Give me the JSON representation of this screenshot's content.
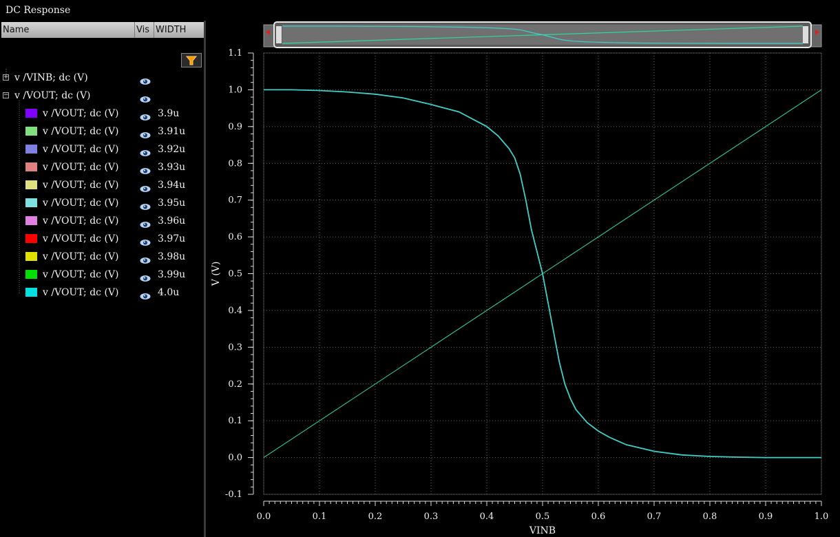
{
  "window": {
    "title": "DC Response"
  },
  "panel": {
    "columns": {
      "name": "Name",
      "vis": "Vis",
      "width": "WIDTH"
    },
    "rows": [
      {
        "label": "v /VINB; dc (V)",
        "expander": "+",
        "color": "",
        "value": ""
      },
      {
        "label": "v /VOUT; dc (V)",
        "expander": "−",
        "color": "",
        "value": ""
      },
      {
        "label": "v /VOUT; dc (V)",
        "color": "#8000ff",
        "value": "3.9u"
      },
      {
        "label": "v /VOUT; dc (V)",
        "color": "#80e080",
        "value": "3.91u"
      },
      {
        "label": "v /VOUT; dc (V)",
        "color": "#8080e0",
        "value": "3.92u"
      },
      {
        "label": "v /VOUT; dc (V)",
        "color": "#e08080",
        "value": "3.93u"
      },
      {
        "label": "v /VOUT; dc (V)",
        "color": "#e0e080",
        "value": "3.94u"
      },
      {
        "label": "v /VOUT; dc (V)",
        "color": "#80e0e0",
        "value": "3.95u"
      },
      {
        "label": "v /VOUT; dc (V)",
        "color": "#e080e0",
        "value": "3.96u"
      },
      {
        "label": "v /VOUT; dc (V)",
        "color": "#ff0000",
        "value": "3.97u"
      },
      {
        "label": "v /VOUT; dc (V)",
        "color": "#e0e000",
        "value": "3.98u"
      },
      {
        "label": "v /VOUT; dc (V)",
        "color": "#00e000",
        "value": "3.99u"
      },
      {
        "label": "v /VOUT; dc (V)",
        "color": "#00e0e0",
        "value": "4.0u"
      }
    ]
  },
  "icons": {
    "filter": "filter-icon",
    "visibility": "eye-icon",
    "expand": "plus-box-icon",
    "collapse": "minus-box-icon"
  },
  "colors": {
    "background": "#000000",
    "grid": "#6a6a6a",
    "vinb_trace": "#2ed9a0",
    "vout_trace": "#3fd0c8"
  },
  "chart_data": {
    "type": "line",
    "title": "",
    "xlabel": "VINB",
    "ylabel": "V (V)",
    "xlim": [
      0.0,
      1.0
    ],
    "ylim": [
      -0.1,
      1.1
    ],
    "grid": true,
    "x_ticks": [
      "0.0",
      "0.1",
      "0.2",
      "0.3",
      "0.4",
      "0.5",
      "0.6",
      "0.7",
      "0.8",
      "0.9",
      "1.0"
    ],
    "y_ticks": [
      "-0.1",
      "0.0",
      "0.1",
      "0.2",
      "0.3",
      "0.4",
      "0.5",
      "0.6",
      "0.7",
      "0.8",
      "0.9",
      "1.0",
      "1.1"
    ],
    "series": [
      {
        "name": "v /VINB; dc (V)",
        "x": [
          0.0,
          1.0
        ],
        "y": [
          0.0,
          1.0
        ]
      },
      {
        "name": "v /VOUT; dc (V)",
        "x": [
          0.0,
          0.05,
          0.1,
          0.15,
          0.2,
          0.25,
          0.3,
          0.35,
          0.4,
          0.42,
          0.44,
          0.45,
          0.46,
          0.47,
          0.48,
          0.49,
          0.5,
          0.51,
          0.52,
          0.53,
          0.54,
          0.55,
          0.56,
          0.58,
          0.6,
          0.62,
          0.65,
          0.7,
          0.75,
          0.8,
          0.85,
          0.9,
          0.95,
          1.0
        ],
        "y": [
          1.0,
          1.0,
          0.998,
          0.994,
          0.988,
          0.978,
          0.96,
          0.94,
          0.9,
          0.875,
          0.84,
          0.815,
          0.77,
          0.7,
          0.62,
          0.56,
          0.5,
          0.42,
          0.34,
          0.26,
          0.2,
          0.16,
          0.13,
          0.095,
          0.072,
          0.055,
          0.035,
          0.017,
          0.007,
          0.003,
          0.001,
          0.0,
          0.0,
          0.0
        ]
      }
    ]
  }
}
